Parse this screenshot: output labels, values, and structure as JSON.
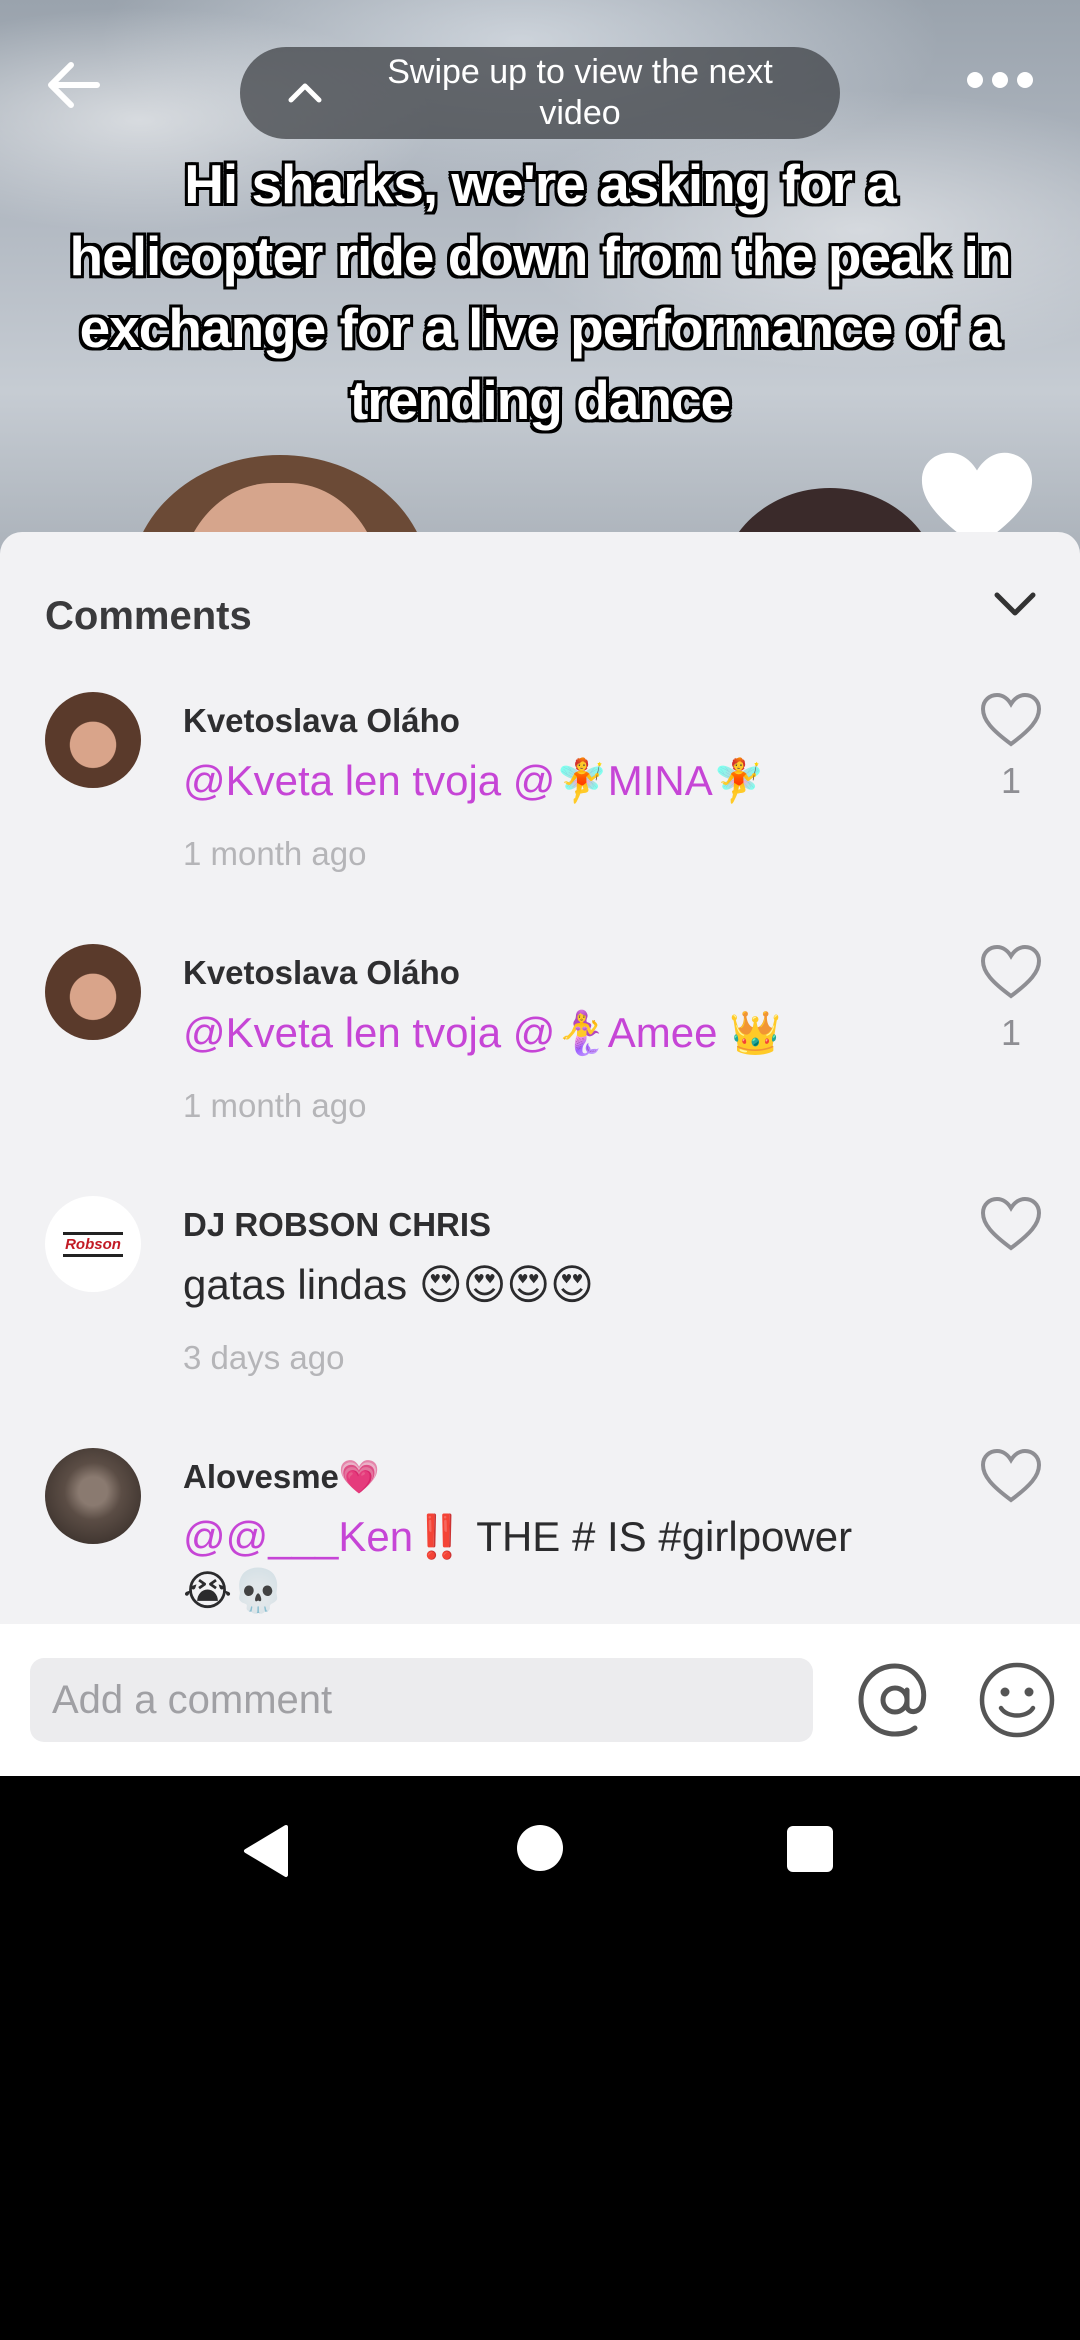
{
  "video": {
    "swipe_hint": "Swipe up to view the next video",
    "caption": "Hi sharks, we're asking for a helicopter ride down from the peak in exchange for a live performance of a trending dance"
  },
  "comments_sheet": {
    "title": "Comments",
    "comments": [
      {
        "username": "Kvetoslava Oláho",
        "text_mention": "@Kveta len tvoja  @🧚MINA🧚",
        "text_plain": "",
        "time": "1 month ago",
        "likes": "1"
      },
      {
        "username": "Kvetoslava Oláho",
        "text_mention": "@Kveta len tvoja  @🧜‍♀️Amee ",
        "text_plain": "👑",
        "time": "1 month ago",
        "likes": "1"
      },
      {
        "username": "DJ ROBSON CHRIS",
        "avatar_text": "Robson",
        "text_mention": "",
        "text_plain": "gatas lindas 😍😍😍😍",
        "time": "3 days ago",
        "likes": ""
      },
      {
        "username": "Alovesme💗",
        "text_mention": "@@___Ken",
        "text_plain": "‼️ THE # IS #girlpower 😭💀",
        "time": "",
        "likes": ""
      }
    ]
  },
  "input_bar": {
    "placeholder": "Add a comment"
  },
  "icons": {
    "back": "back-arrow-icon",
    "chevron_up": "chevron-up-icon",
    "more": "more-dots-icon",
    "collapse": "chevron-down-icon",
    "like": "heart-outline-icon",
    "mention": "at-sign-icon",
    "emoji": "smiley-icon"
  },
  "colors": {
    "mention": "#c645d6",
    "sheet_bg": "#f2f2f4",
    "time_text": "#b5b5b8"
  }
}
